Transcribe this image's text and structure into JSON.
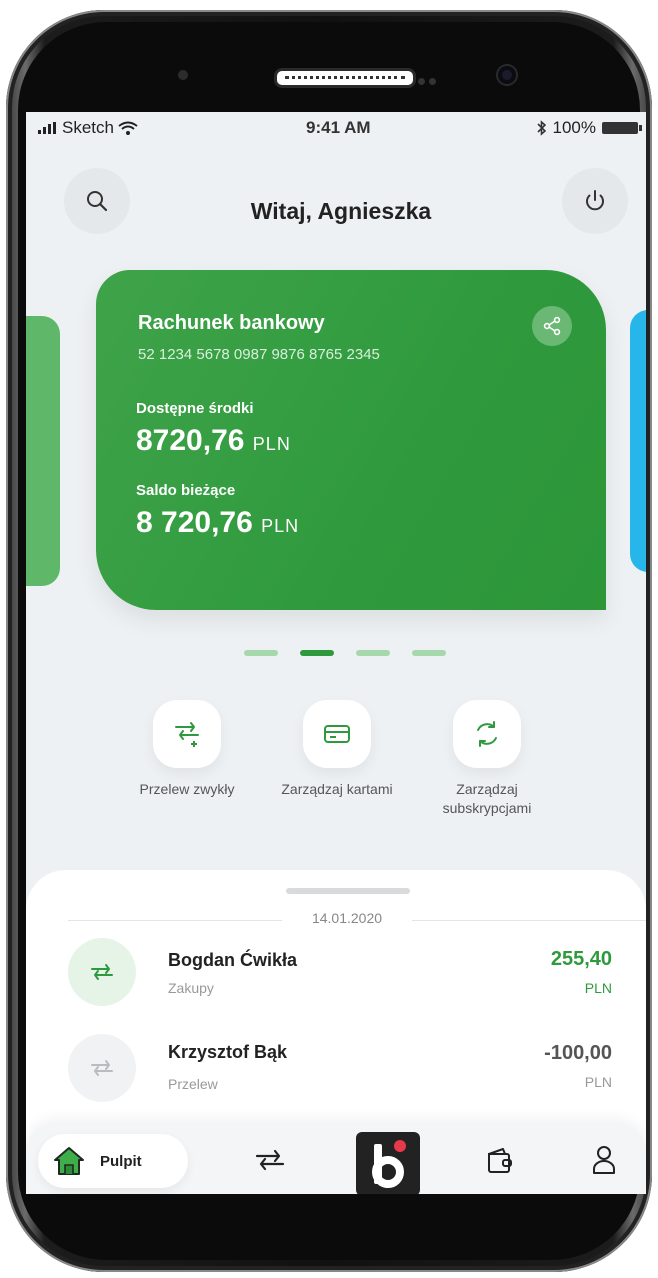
{
  "status_bar": {
    "carrier": "Sketch",
    "time": "9:41 AM",
    "battery": "100%"
  },
  "header": {
    "greeting": "Witaj, Agnieszka"
  },
  "account_card": {
    "title": "Rachunek bankowy",
    "number": "52 1234 5678 0987 9876 8765 2345",
    "available_label": "Dostępne środki",
    "available_amount": "8720,76",
    "available_currency": "PLN",
    "balance_label": "Saldo bieżące",
    "balance_amount": "8 720,76",
    "balance_currency": "PLN",
    "color": "#2f9a3d"
  },
  "pager": {
    "count": 4,
    "active_index": 1
  },
  "quick_actions": [
    {
      "label": "Przelew zwykły",
      "icon": "transfer-plus-icon"
    },
    {
      "label": "Zarządzaj kartami",
      "icon": "card-icon"
    },
    {
      "label": "Zarządzaj subskrypcjami",
      "icon": "refresh-icon"
    }
  ],
  "transactions": {
    "date": "14.01.2020",
    "items": [
      {
        "name": "Bogdan Ćwikła",
        "type": "Zakupy",
        "amount": "255,40",
        "currency": "PLN",
        "color": "#2f9a3d"
      },
      {
        "name": "Krzysztof Bąk",
        "type": "Przelew",
        "amount": "-100,00",
        "currency": "PLN",
        "color": "#555555"
      }
    ]
  },
  "tab_bar": {
    "home_label": "Pulpit"
  },
  "colors": {
    "accent": "#2f9a3d",
    "side_card_right": "#27b6ea"
  }
}
